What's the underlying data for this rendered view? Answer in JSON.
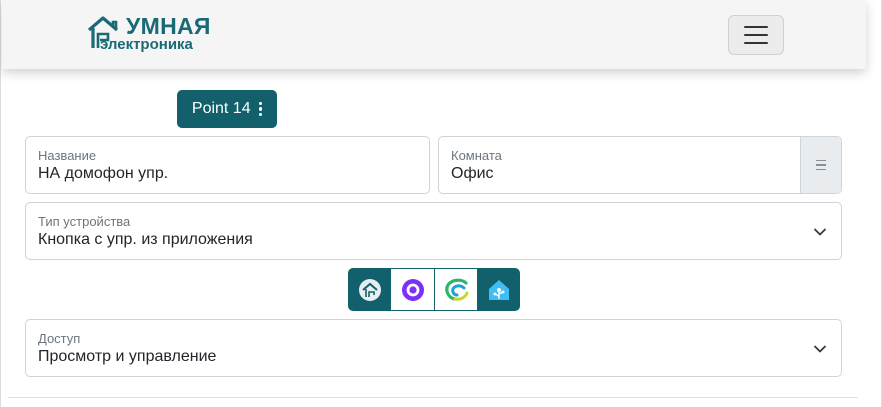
{
  "header": {
    "logo_line1": "УМНАЯ",
    "logo_line2": "электроника",
    "brand_color": "#1a6a75",
    "menu_icon": "hamburger-icon"
  },
  "device": {
    "point_label": "Point 14",
    "point_menu_icon": "kebab-vertical-icon",
    "accent_color": "#11606b"
  },
  "form": {
    "name": {
      "label": "Название",
      "value": "НА домофон упр."
    },
    "room": {
      "label": "Комната",
      "value": "Офис",
      "side_icon": "list-icon"
    },
    "device_type": {
      "label": "Тип устройства",
      "value": "Кнопка с упр. из приложения",
      "icon": "chevron-down-icon"
    },
    "access": {
      "label": "Доступ",
      "value": "Просмотр и управление",
      "icon": "chevron-down-icon"
    }
  },
  "integrations": [
    {
      "name": "smart-home-app-icon",
      "active": true
    },
    {
      "name": "alice-icon",
      "active": false
    },
    {
      "name": "sber-icon",
      "active": false
    },
    {
      "name": "home-assistant-icon",
      "active": true
    }
  ]
}
